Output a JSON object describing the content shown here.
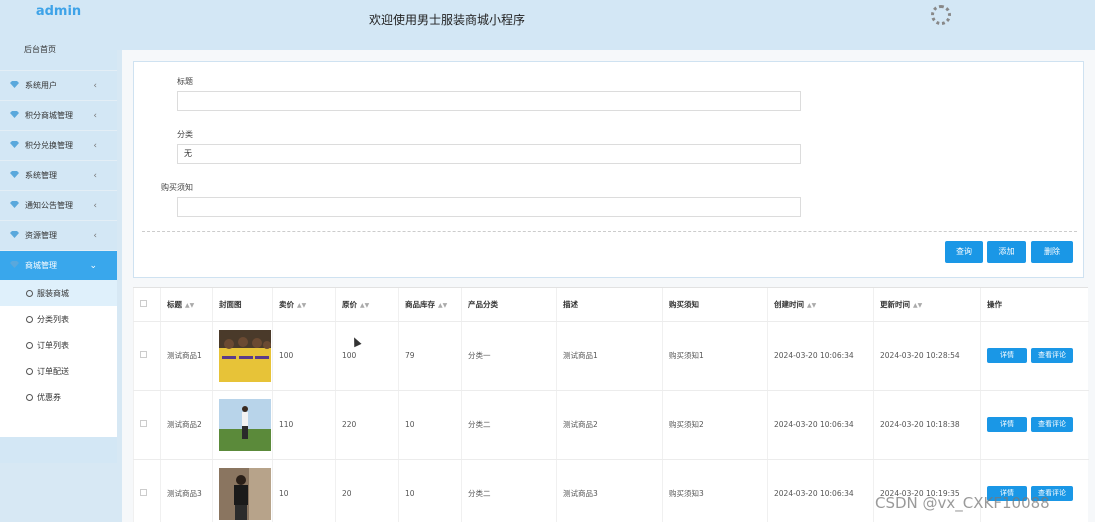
{
  "app": {
    "brand": "admin",
    "header_title": "欢迎使用男士服装商城小程序"
  },
  "sidebar": {
    "home": "后台首页",
    "menus": [
      {
        "label": "系统用户"
      },
      {
        "label": "积分商城管理"
      },
      {
        "label": "积分兑换管理"
      },
      {
        "label": "系统管理"
      },
      {
        "label": "通知公告管理"
      },
      {
        "label": "资源管理"
      },
      {
        "label": "商城管理",
        "active": true
      }
    ],
    "submenu": [
      {
        "label": "服装商城",
        "active": true
      },
      {
        "label": "分类列表"
      },
      {
        "label": "订单列表"
      },
      {
        "label": "订单配送"
      },
      {
        "label": "优惠券"
      }
    ]
  },
  "form": {
    "title_label": "标题",
    "title_value": "",
    "category_label": "分类",
    "category_value": "无",
    "notice_label": "购买须知",
    "notice_value": ""
  },
  "actions": {
    "query": "查询",
    "add": "添加",
    "delete": "删除"
  },
  "table": {
    "headers": [
      "标题",
      "封面图",
      "卖价",
      "原价",
      "商品库存",
      "产品分类",
      "描述",
      "购买须知",
      "创建时间",
      "更新时间",
      "操作"
    ],
    "rows": [
      {
        "title": "测试商品1",
        "price": "100",
        "orig": "100",
        "stock": "79",
        "cat": "分类一",
        "desc": "测试商品1",
        "notice": "购买须知1",
        "created": "2024-03-20 10:06:34",
        "updated": "2024-03-20 10:28:54"
      },
      {
        "title": "测试商品2",
        "price": "110",
        "orig": "220",
        "stock": "10",
        "cat": "分类二",
        "desc": "测试商品2",
        "notice": "购买须知2",
        "created": "2024-03-20 10:06:34",
        "updated": "2024-03-20 10:18:38"
      },
      {
        "title": "测试商品3",
        "price": "10",
        "orig": "20",
        "stock": "10",
        "cat": "分类二",
        "desc": "测试商品3",
        "notice": "购买须知3",
        "created": "2024-03-20 10:06:34",
        "updated": "2024-03-20 10:19:35"
      }
    ],
    "detail_label": "详情",
    "review_label": "查看评论"
  },
  "watermark": "CSDN @vx_CXKF10088"
}
